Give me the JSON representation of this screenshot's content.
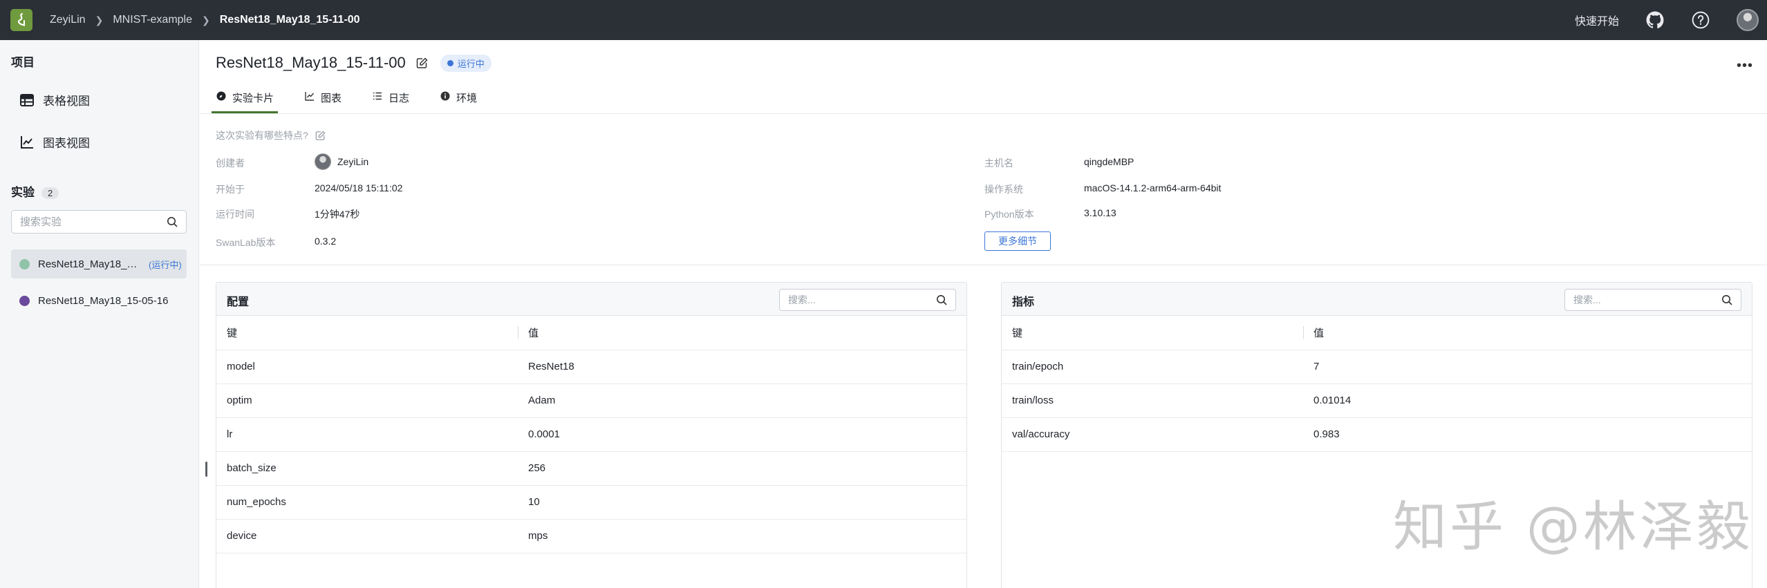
{
  "topbar": {
    "breadcrumbs": [
      "ZeyiLin",
      "MNIST-example",
      "ResNet18_May18_15-11-00"
    ],
    "quickstart": "快速开始",
    "icons": [
      "swanlab-logo-icon",
      "github-icon",
      "help-icon",
      "avatar"
    ]
  },
  "sidebar": {
    "project_title": "项目",
    "nav": [
      {
        "label": "表格视图",
        "icon": "table-icon"
      },
      {
        "label": "图表视图",
        "icon": "chart-icon"
      }
    ],
    "experiments_title": "实验",
    "experiments_count": "2",
    "search_placeholder": "搜索实验",
    "experiments": [
      {
        "name": "ResNet18_May18_15-11-00",
        "display": "ResNet18_May18_1...",
        "status": "(运行中)",
        "color": "#8fc4a8",
        "active": true
      },
      {
        "name": "ResNet18_May18_15-05-16",
        "display": "ResNet18_May18_15-05-16",
        "status": "",
        "color": "#6a4a9c",
        "active": false
      }
    ]
  },
  "header": {
    "title": "ResNet18_May18_15-11-00",
    "status": "运行中",
    "tabs": [
      {
        "label": "实验卡片",
        "icon": "card-icon",
        "active": true
      },
      {
        "label": "图表",
        "icon": "line-chart-icon",
        "active": false
      },
      {
        "label": "日志",
        "icon": "list-icon",
        "active": false
      },
      {
        "label": "环境",
        "icon": "info-icon",
        "active": false
      }
    ]
  },
  "info": {
    "question": "这次实验有哪些特点?",
    "creator_label": "创建者",
    "creator": "ZeyiLin",
    "start_label": "开始于",
    "start": "2024/05/18 15:11:02",
    "duration_label": "运行时间",
    "duration": "1分钟47秒",
    "version_label": "SwanLab版本",
    "version": "0.3.2",
    "host_label": "主机名",
    "host": "qingdeMBP",
    "os_label": "操作系统",
    "os": "macOS-14.1.2-arm64-arm-64bit",
    "python_label": "Python版本",
    "python": "3.10.13",
    "more_button": "更多细节"
  },
  "config": {
    "title": "配置",
    "search_placeholder": "搜索...",
    "col_key": "键",
    "col_value": "值",
    "rows": [
      {
        "key": "model",
        "value": "ResNet18"
      },
      {
        "key": "optim",
        "value": "Adam"
      },
      {
        "key": "lr",
        "value": "0.0001"
      },
      {
        "key": "batch_size",
        "value": "256"
      },
      {
        "key": "num_epochs",
        "value": "10"
      },
      {
        "key": "device",
        "value": "mps"
      }
    ]
  },
  "metrics": {
    "title": "指标",
    "search_placeholder": "搜索...",
    "col_key": "键",
    "col_value": "值",
    "rows": [
      {
        "key": "train/epoch",
        "value": "7"
      },
      {
        "key": "train/loss",
        "value": "0.01014"
      },
      {
        "key": "val/accuracy",
        "value": "0.983"
      }
    ]
  },
  "watermark": "知乎 @林泽毅"
}
